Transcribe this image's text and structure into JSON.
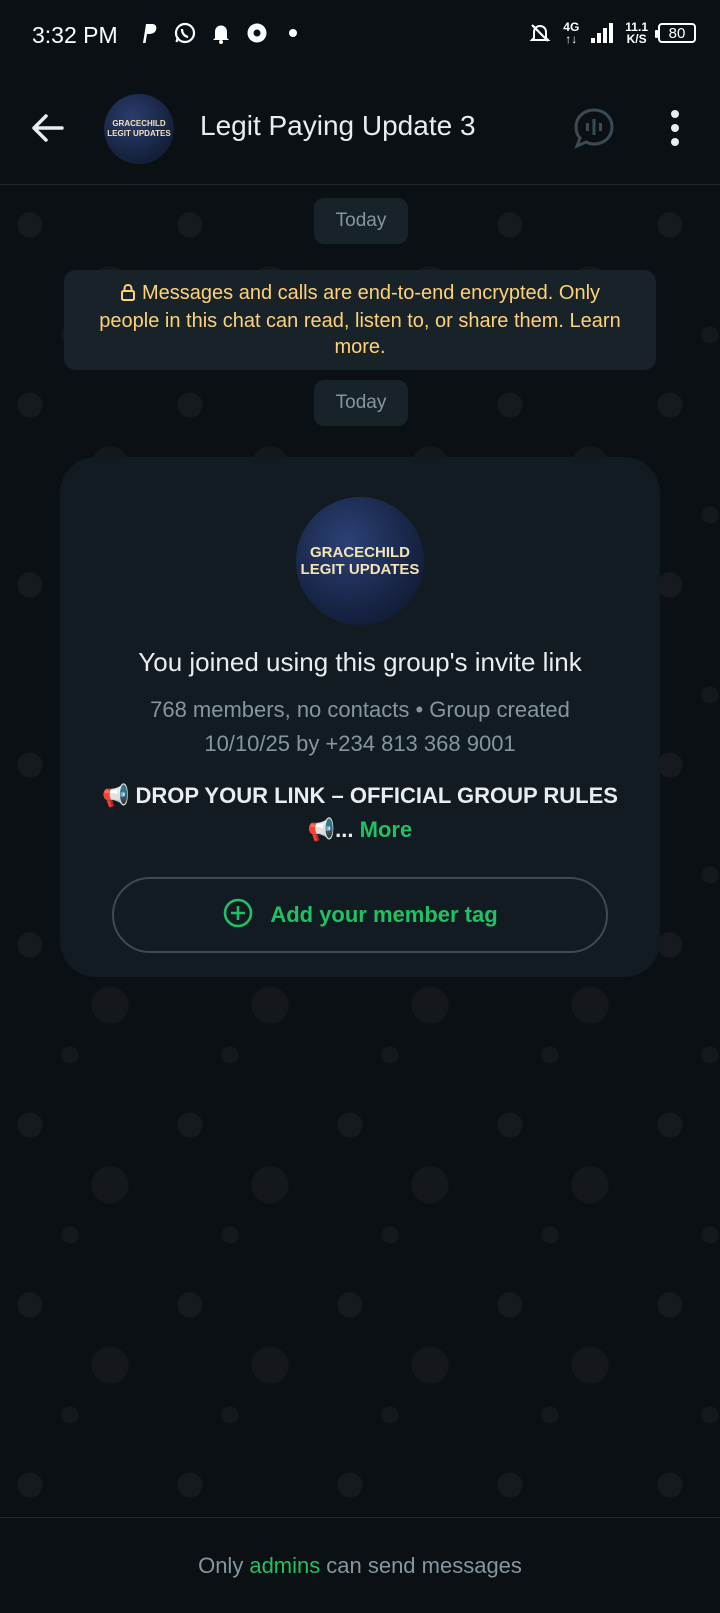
{
  "status_bar": {
    "time": "3:32 PM",
    "network_type": "4G",
    "speed_value": "11.1",
    "speed_unit": "K/S",
    "battery": "80"
  },
  "header": {
    "title": "Legit Paying Update 3",
    "avatar_line1": "GRACECHILD",
    "avatar_line2": "LEGIT UPDATES"
  },
  "chat": {
    "date_chip_1": "Today",
    "encryption_notice": "Messages and calls are end-to-end encrypted. Only people in this chat can read, listen to, or share them. Learn more.",
    "date_chip_2": "Today"
  },
  "group_card": {
    "avatar_line1": "GRACECHILD",
    "avatar_line2": "LEGIT UPDATES",
    "title": "You joined using this group's invite link",
    "meta": "768 members, no contacts • Group created 10/10/25 by +234 813 368 9001",
    "description": "📢 DROP YOUR LINK – OFFICIAL GROUP RULES 📢...",
    "more_label": "More",
    "tag_button_label": "Add your member tag"
  },
  "footer": {
    "prefix": "Only",
    "admins_link": "admins",
    "suffix": "can send messages"
  },
  "colors": {
    "accent_green": "#21c063",
    "encryption_text": "#ffd279",
    "background": "#0b1014",
    "card_bg": "#111b21"
  }
}
